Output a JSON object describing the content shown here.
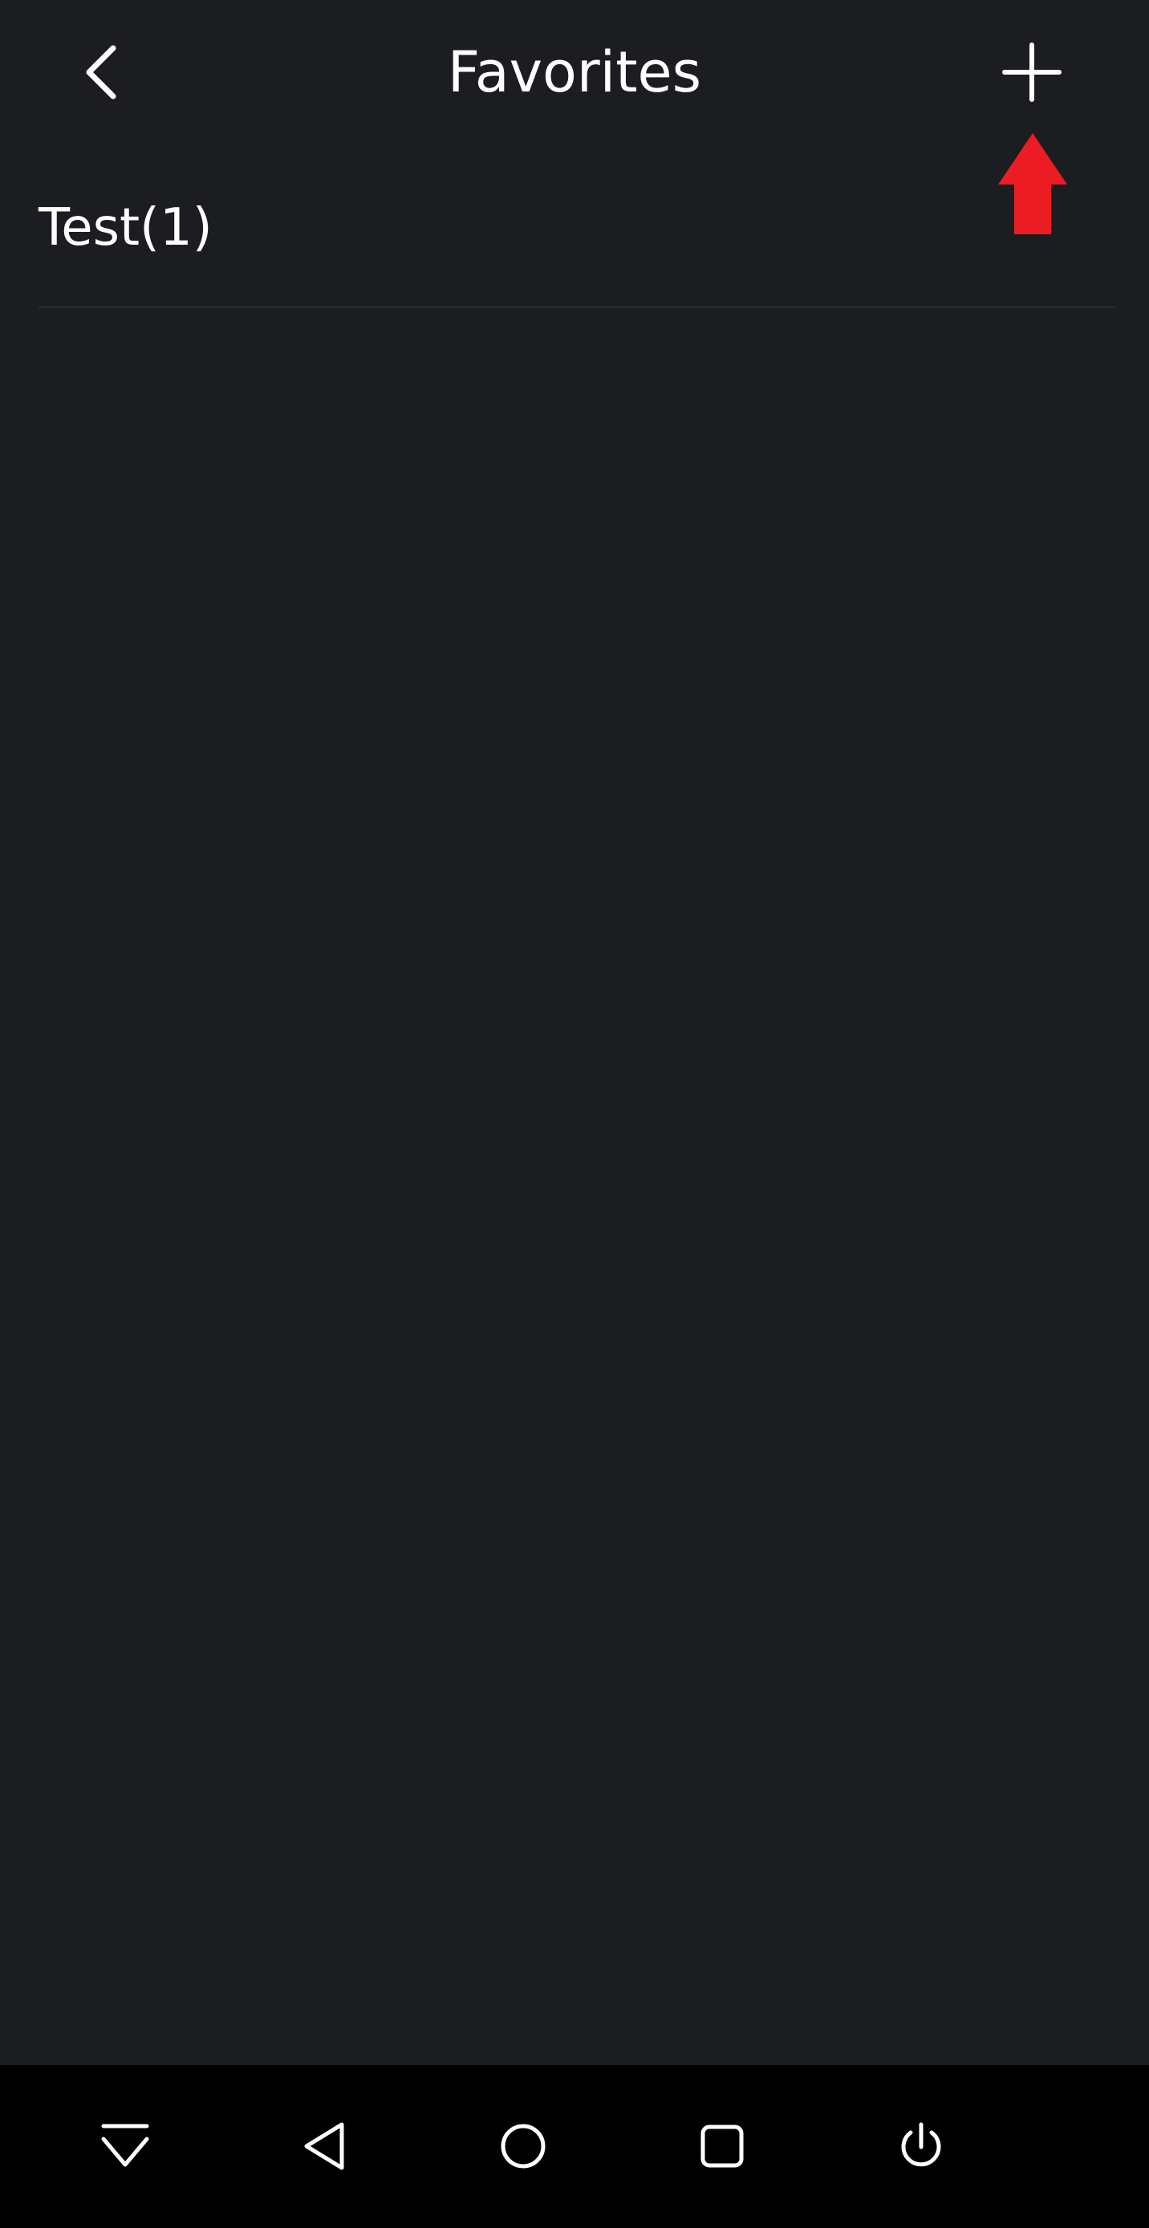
{
  "header": {
    "title": "Favorites",
    "back_icon": "chevron-left-icon",
    "add_icon": "plus-icon"
  },
  "annotation": {
    "icon": "arrow-up-icon",
    "color": "#ec1c24"
  },
  "favorites": [
    {
      "label": "Test(1)"
    }
  ],
  "navbar": {
    "items": [
      {
        "icon": "notification-shade-icon"
      },
      {
        "icon": "back-triangle-icon"
      },
      {
        "icon": "home-circle-icon"
      },
      {
        "icon": "recents-square-icon"
      },
      {
        "icon": "power-icon"
      }
    ]
  },
  "colors": {
    "background": "#1c1d21",
    "text": "#ffffff",
    "divider": "#2a2c31",
    "navbar": "#000000"
  }
}
